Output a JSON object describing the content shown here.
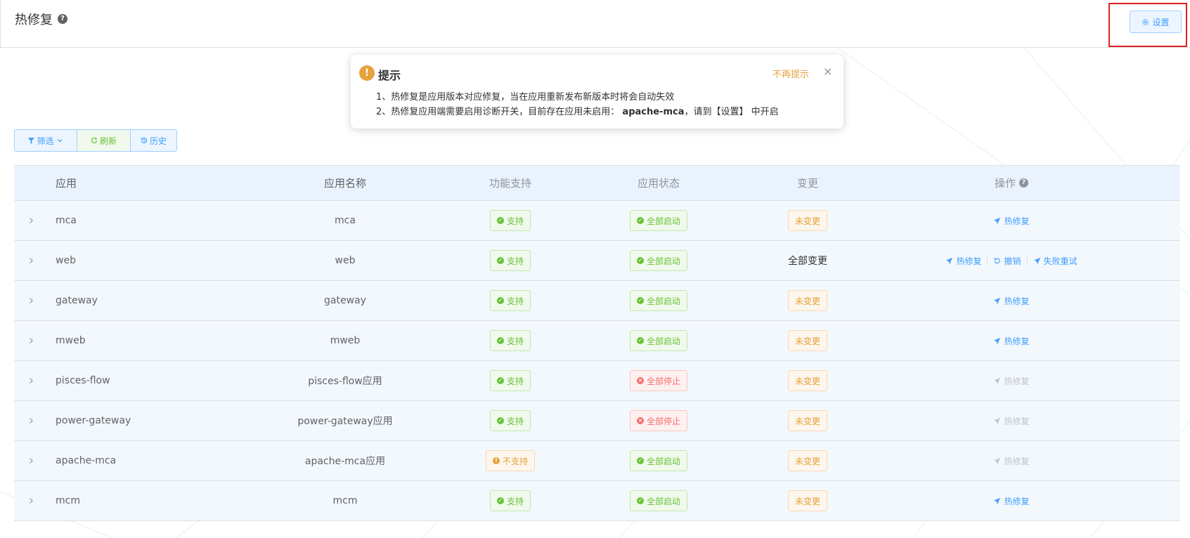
{
  "header": {
    "title": "热修复",
    "help_glyph": "?",
    "settings_label": "设置"
  },
  "notice": {
    "icon_glyph": "!",
    "title": "提示",
    "dismiss_label": "不再提示",
    "close_glyph": "×",
    "line1": "1、热修复是应用版本对应修复，当在应用重新发布新版本时将会自动失效",
    "line2_prefix": "2、热修复应用端需要启用诊断开关，目前存在应用未启用：",
    "line2_app": "apache-mca",
    "line2_suffix": "，请到【设置】 中开启"
  },
  "toolbar": {
    "filter_label": "筛选",
    "refresh_label": "刷新",
    "history_label": "历史"
  },
  "table": {
    "headers": {
      "app": "应用",
      "name": "应用名称",
      "feature": "功能支持",
      "status": "应用状态",
      "change": "变更",
      "operation": "操作"
    },
    "rows": [
      {
        "app": "mca",
        "name": "mca",
        "feature": "支持",
        "status": "全部启动",
        "change": "未变更",
        "ops": [
          "热修复"
        ]
      },
      {
        "app": "web",
        "name": "web",
        "feature": "支持",
        "status": "全部启动",
        "change": "全部变更",
        "ops": [
          "热修复",
          "撤销",
          "失败重试"
        ]
      },
      {
        "app": "gateway",
        "name": "gateway",
        "feature": "支持",
        "status": "全部启动",
        "change": "未变更",
        "ops": [
          "热修复"
        ]
      },
      {
        "app": "mweb",
        "name": "mweb",
        "feature": "支持",
        "status": "全部启动",
        "change": "未变更",
        "ops": [
          "热修复"
        ]
      },
      {
        "app": "pisces-flow",
        "name": "pisces-flow应用",
        "feature": "支持",
        "status": "全部停止",
        "change": "未变更",
        "ops": [
          "热修复"
        ]
      },
      {
        "app": "power-gateway",
        "name": "power-gateway应用",
        "feature": "支持",
        "status": "全部停止",
        "change": "未变更",
        "ops": [
          "热修复"
        ]
      },
      {
        "app": "apache-mca",
        "name": "apache-mca应用",
        "feature": "不支持",
        "status": "全部启动",
        "change": "未变更",
        "ops": [
          "热修复"
        ]
      },
      {
        "app": "mcm",
        "name": "mcm",
        "feature": "支持",
        "status": "全部启动",
        "change": "未变更",
        "ops": [
          "热修复"
        ]
      }
    ]
  },
  "colors": {
    "primary": "#409eff",
    "success": "#67c23a",
    "danger": "#f56c6c",
    "warning": "#e6a23c",
    "highlight_box": "#e02020"
  }
}
